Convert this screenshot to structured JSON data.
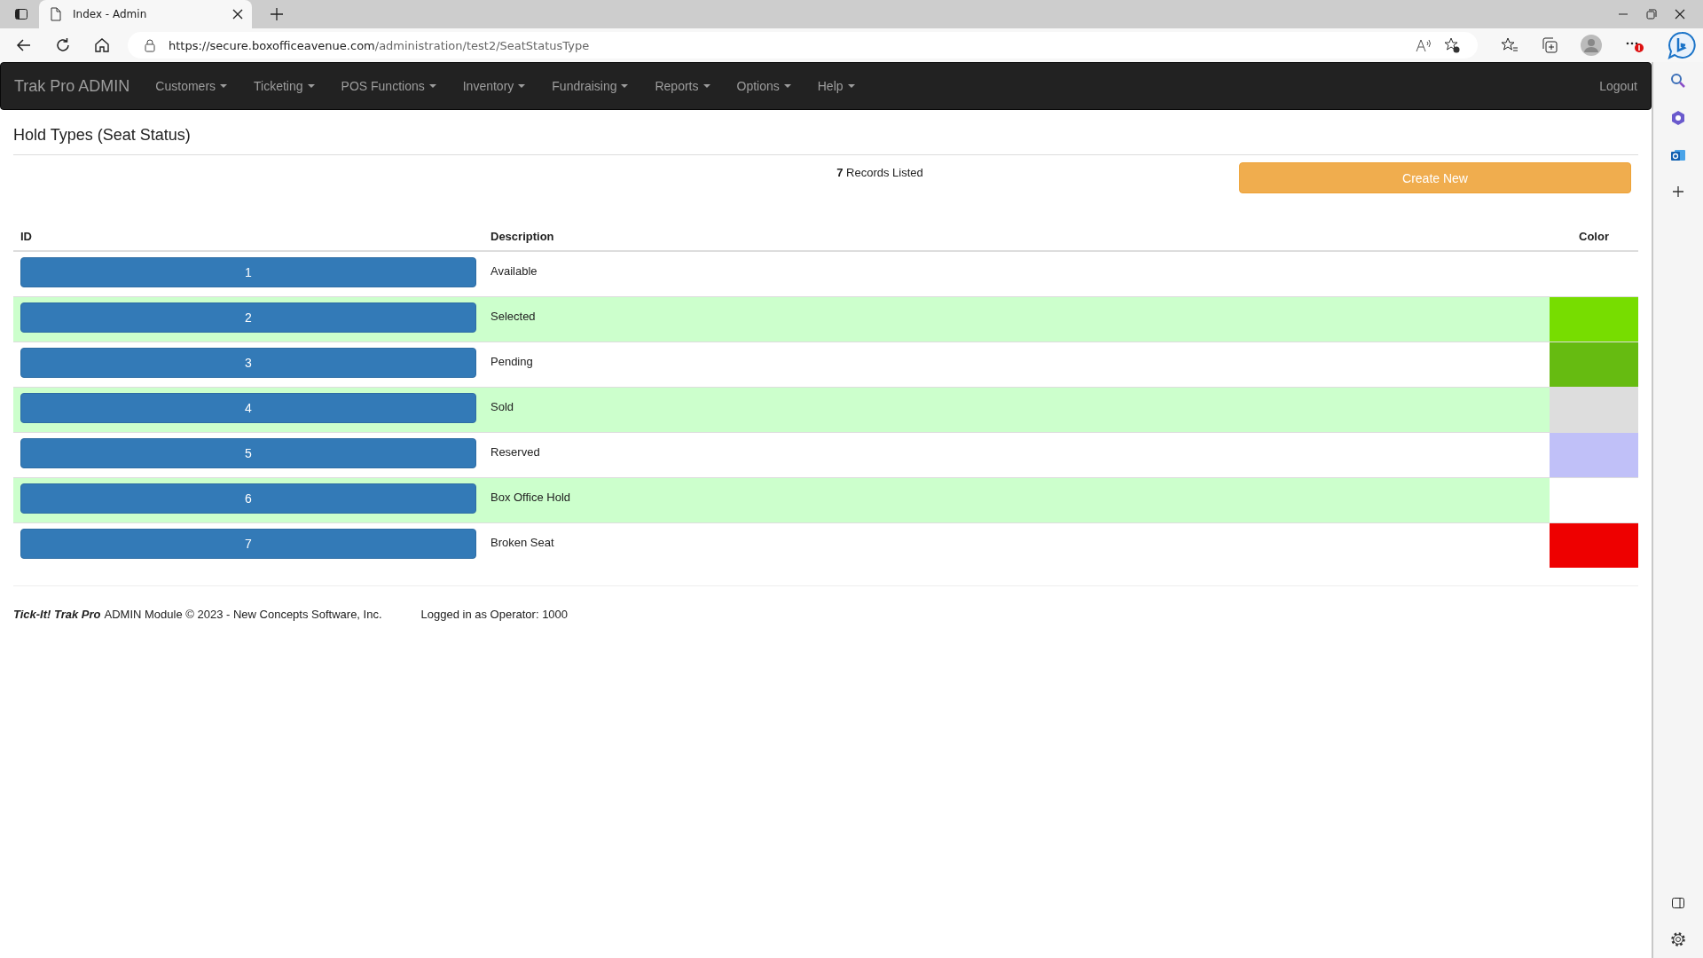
{
  "browser": {
    "tab": {
      "title": "Index - Admin"
    },
    "url": {
      "host": "https://secure.boxofficeavenue.com",
      "path": "/administration/test2/SeatStatusType"
    }
  },
  "navbar": {
    "brand": "Trak Pro ADMIN",
    "items": [
      {
        "label": "Customers",
        "dropdown": true
      },
      {
        "label": "Ticketing",
        "dropdown": true
      },
      {
        "label": "POS Functions",
        "dropdown": true
      },
      {
        "label": "Inventory",
        "dropdown": true
      },
      {
        "label": "Fundraising",
        "dropdown": true
      },
      {
        "label": "Reports",
        "dropdown": true
      },
      {
        "label": "Options",
        "dropdown": true
      },
      {
        "label": "Help",
        "dropdown": true
      }
    ],
    "logout": "Logout"
  },
  "page": {
    "title": "Hold Types (Seat Status)",
    "records": "**7** Records Listed",
    "create_button": "Create New"
  },
  "table": {
    "columns": [
      "ID",
      "Description",
      "Color"
    ],
    "rows": [
      {
        "id": "1",
        "description": "Available"
      },
      {
        "id": "2",
        "description": "Selected",
        "color": "#77dd00"
      },
      {
        "id": "3",
        "description": "Pending",
        "color": "#66bb11"
      },
      {
        "id": "4",
        "description": "Sold",
        "color": "#dddddd"
      },
      {
        "id": "5",
        "description": "Reserved",
        "color": "#c0c0f8"
      },
      {
        "id": "6",
        "description": "Box Office Hold",
        "color": "#ffffff"
      },
      {
        "id": "7",
        "description": "Broken Seat",
        "color": "#ee0000"
      }
    ]
  },
  "footer": {
    "brand": "Tick-It! Trak Pro",
    "text": "ADMIN Module © 2023 - New Concepts Software, Inc.",
    "operator": "Logged in as Operator: 1000"
  }
}
